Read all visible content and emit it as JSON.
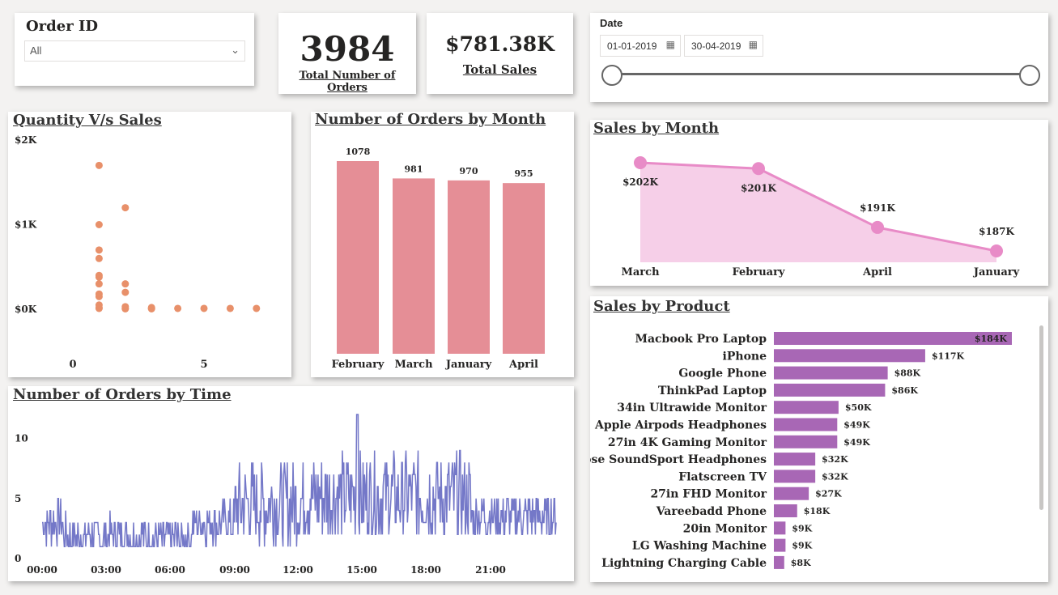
{
  "order_id": {
    "label": "Order ID",
    "value": "All"
  },
  "kpis": {
    "orders_value": "3984",
    "orders_label": "Total Number of Orders",
    "sales_value": "$781.38K",
    "sales_label": "Total Sales"
  },
  "date": {
    "label": "Date",
    "start": "01-01-2019",
    "end": "30-04-2019"
  },
  "titles": {
    "scatter": "Quantity V/s Sales",
    "bars": "Number of Orders by Month",
    "line": "Number of Orders by Time",
    "area": "Sales by Month",
    "product": "Sales by Product"
  },
  "colors": {
    "scatter": "#e8906a",
    "bars": "#e58e96",
    "line": "#7478c8",
    "area_line": "#e88bc7",
    "area_fill": "#f6cfe8",
    "product": "#a867b5"
  },
  "chart_data": [
    {
      "type": "scatter",
      "title": "Quantity V/s Sales",
      "x_ticks": [
        "0",
        "5"
      ],
      "y_ticks": [
        "$0K",
        "$1K",
        "$2K"
      ],
      "xlim": [
        -1,
        8.5
      ],
      "ylim": [
        -100,
        2000
      ],
      "points": [
        [
          1,
          1700
        ],
        [
          1,
          1000
        ],
        [
          1,
          700
        ],
        [
          1,
          600
        ],
        [
          1,
          400
        ],
        [
          1,
          380
        ],
        [
          1,
          300
        ],
        [
          1,
          180
        ],
        [
          1,
          150
        ],
        [
          1,
          50
        ],
        [
          1,
          10
        ],
        [
          1,
          20
        ],
        [
          2,
          1200
        ],
        [
          2,
          300
        ],
        [
          2,
          200
        ],
        [
          2,
          30
        ],
        [
          2,
          10
        ],
        [
          2,
          5
        ],
        [
          3,
          20
        ],
        [
          3,
          10
        ],
        [
          3,
          5
        ],
        [
          4,
          10
        ],
        [
          5,
          10
        ],
        [
          6,
          10
        ],
        [
          7,
          10
        ]
      ]
    },
    {
      "type": "bar",
      "title": "Number of Orders by Month",
      "categories": [
        "February",
        "March",
        "January",
        "April"
      ],
      "values": [
        1078,
        981,
        970,
        955
      ],
      "labels": [
        "1078",
        "981",
        "970",
        "955"
      ],
      "ylim": [
        0,
        1200
      ]
    },
    {
      "type": "line",
      "title": "Number of Orders by Time",
      "x_ticks": [
        "00:00",
        "03:00",
        "06:00",
        "09:00",
        "12:00",
        "15:00",
        "18:00",
        "21:00"
      ],
      "y_ticks": [
        "0",
        "5",
        "10"
      ],
      "ylim": [
        0,
        12
      ],
      "x_range_minutes": [
        0,
        1439
      ]
    },
    {
      "type": "area",
      "title": "Sales by Month",
      "categories": [
        "March",
        "February",
        "April",
        "January"
      ],
      "values": [
        202,
        201,
        191,
        187
      ],
      "labels": [
        "$202K",
        "$201K",
        "$191K",
        "$187K"
      ],
      "ylim": [
        185,
        203
      ]
    },
    {
      "type": "bar",
      "orientation": "horizontal",
      "title": "Sales by Product",
      "categories": [
        "Macbook Pro Laptop",
        "iPhone",
        "Google Phone",
        "ThinkPad Laptop",
        "34in Ultrawide Monitor",
        "Apple Airpods Headphones",
        "27in 4K Gaming Monitor",
        "Bose SoundSport Headphones",
        "Flatscreen TV",
        "27in FHD Monitor",
        "Vareebadd Phone",
        "20in Monitor",
        "LG Washing Machine",
        "Lightning Charging Cable"
      ],
      "values": [
        184,
        117,
        88,
        86,
        50,
        49,
        49,
        32,
        32,
        27,
        18,
        9,
        9,
        8
      ],
      "labels": [
        "$184K",
        "$117K",
        "$88K",
        "$86K",
        "$50K",
        "$49K",
        "$49K",
        "$32K",
        "$32K",
        "$27K",
        "$18K",
        "$9K",
        "$9K",
        "$8K"
      ]
    }
  ]
}
